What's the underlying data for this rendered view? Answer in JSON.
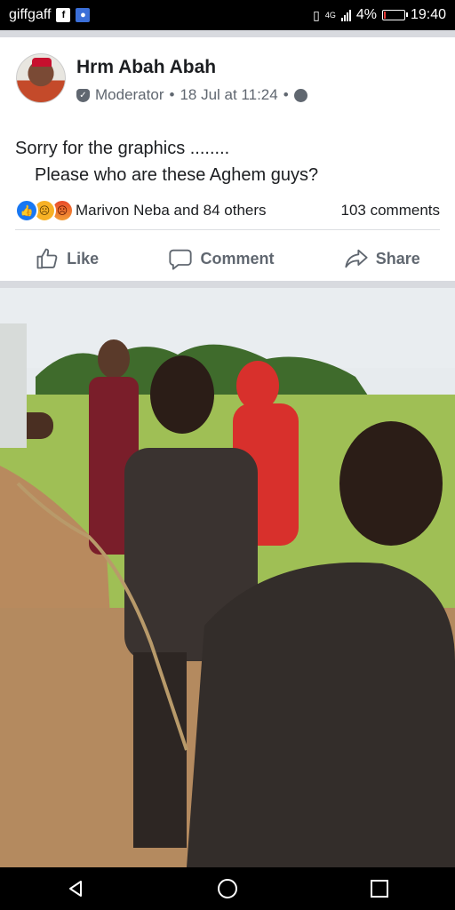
{
  "status_bar": {
    "carrier": "giffgaff",
    "network": "4G",
    "battery": "4%",
    "battery_level": 0.04,
    "time": "19:40"
  },
  "post": {
    "author": "Hrm Abah Abah",
    "role": "Moderator",
    "separator": "•",
    "timestamp": "18 Jul at 11:24",
    "privacy_icon": "globe-icon",
    "text_line1": "Sorry for the graphics ........",
    "text_line2": "Please who are these Aghem guys?",
    "reactions": {
      "icons": [
        "like-icon",
        "sad-icon",
        "angry-icon"
      ],
      "summary": "Marivon Neba and 84 others",
      "comments": "103 comments"
    },
    "actions": {
      "like": "Like",
      "comment": "Comment",
      "share": "Share"
    }
  },
  "colors": {
    "facebook_blue": "#1877f2",
    "secondary_text": "#606770",
    "primary_text": "#1c1e21",
    "separator": "#d8dadf"
  }
}
